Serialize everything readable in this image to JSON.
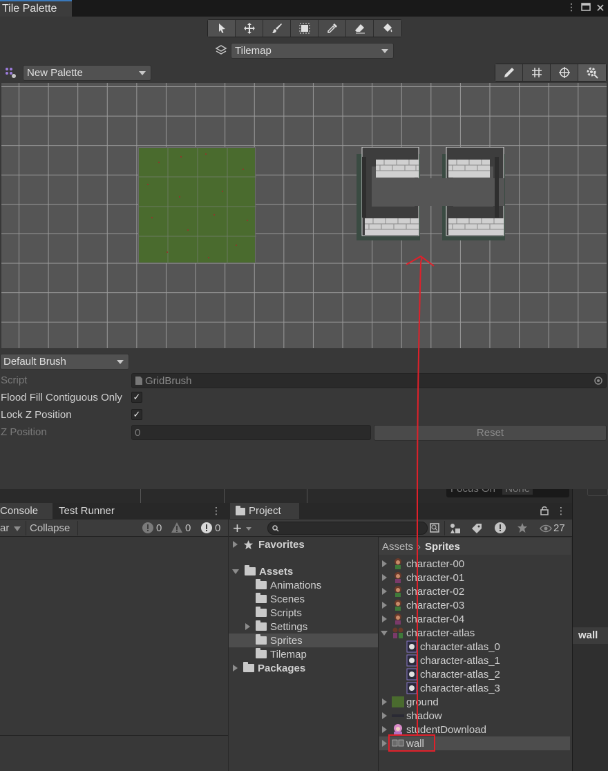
{
  "tile_palette": {
    "tab_title": "Tile Palette",
    "menu_icon": "kebab-icon",
    "tilemap_target": "Tilemap",
    "palette": "New Palette",
    "brush": "Default Brush",
    "script_label": "Script",
    "script_value": "GridBrush",
    "flood_fill_label": "Flood Fill Contiguous Only",
    "lock_z_label": "Lock Z Position",
    "z_position_label": "Z Position",
    "z_position_value": "0",
    "reset_label": "Reset",
    "flood_fill_checked": true,
    "lock_z_checked": true
  },
  "behind_window": {
    "focus_on_label": "Focus On",
    "focus_on_value": "None"
  },
  "console": {
    "tabs": [
      "Console",
      "Test Runner"
    ],
    "clear_partial": "ar",
    "collapse_label": "Collapse",
    "log_count": "0",
    "warning_count": "0",
    "error_count": "0"
  },
  "project": {
    "tab_title": "Project",
    "add_label": "+",
    "hidden_count": "27",
    "tree": {
      "favorites": "Favorites",
      "assets": "Assets",
      "folders": [
        "Animations",
        "Scenes",
        "Scripts",
        "Settings",
        "Sprites",
        "Tilemap"
      ],
      "packages": "Packages"
    },
    "breadcrumb": [
      "Assets",
      "Sprites"
    ],
    "assets": [
      {
        "name": "character-00"
      },
      {
        "name": "character-01"
      },
      {
        "name": "character-02"
      },
      {
        "name": "character-03"
      },
      {
        "name": "character-04"
      },
      {
        "name": "character-atlas"
      },
      {
        "name": "character-atlas_0"
      },
      {
        "name": "character-atlas_1"
      },
      {
        "name": "character-atlas_2"
      },
      {
        "name": "character-atlas_3"
      },
      {
        "name": "ground"
      },
      {
        "name": "shadow"
      },
      {
        "name": "studentDownload"
      },
      {
        "name": "wall"
      }
    ]
  },
  "inspector_partial": {
    "label": "wall"
  },
  "colors": {
    "annotation_red": "#e0202a",
    "grass": "#4a6b2e",
    "selection": "#2c5d87"
  }
}
